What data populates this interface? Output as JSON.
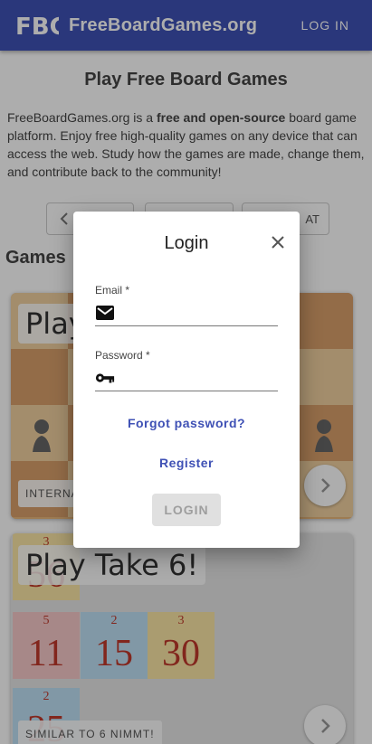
{
  "appbar": {
    "title": "FreeBoardGames.org",
    "login_label": "LOG IN",
    "logo_text": "FBG"
  },
  "page": {
    "heading": "Play Free Board Games",
    "intro_prefix": "FreeBoardGames.org is a ",
    "intro_bold": "free and open-source",
    "intro_suffix": " board game platform. Enjoy free high-quality games on any device that can access the web. Study how the games are made, change them, and contribute back to the community!",
    "filter_pills": [
      "",
      "",
      "AT"
    ],
    "games_label": "Games"
  },
  "cards": [
    {
      "title": "Play",
      "tag": "INTERNA"
    },
    {
      "title": "Play Take 6!",
      "tag": "SIMILAR TO 6 NIMMT!",
      "tiles": [
        {
          "small": "3",
          "big": "56",
          "color": "#fbe6a6"
        },
        {
          "small": "5",
          "big": "11",
          "color": "#f6c9c9"
        },
        {
          "small": "2",
          "big": "15",
          "color": "#bfe0f5"
        },
        {
          "small": "3",
          "big": "30",
          "color": "#fbe6a6"
        },
        {
          "small": "2",
          "big": "25",
          "color": "#bfe0f5"
        }
      ]
    }
  ],
  "dialog": {
    "title": "Login",
    "email_label": "Email *",
    "email_value": "",
    "password_label": "Password *",
    "password_value": "",
    "forgot_label": "Forgot password?",
    "register_label": "Register",
    "login_label": "LOGIN"
  },
  "colors": {
    "primary": "#3f51b5",
    "scrim": "rgba(0,0,0,0.32)",
    "disabled_button": "#e0e0e0"
  },
  "icons": {
    "close": "close-icon",
    "email": "email-icon",
    "password": "key-icon",
    "next": "chevron-right-icon",
    "prev": "chevron-left-icon"
  }
}
